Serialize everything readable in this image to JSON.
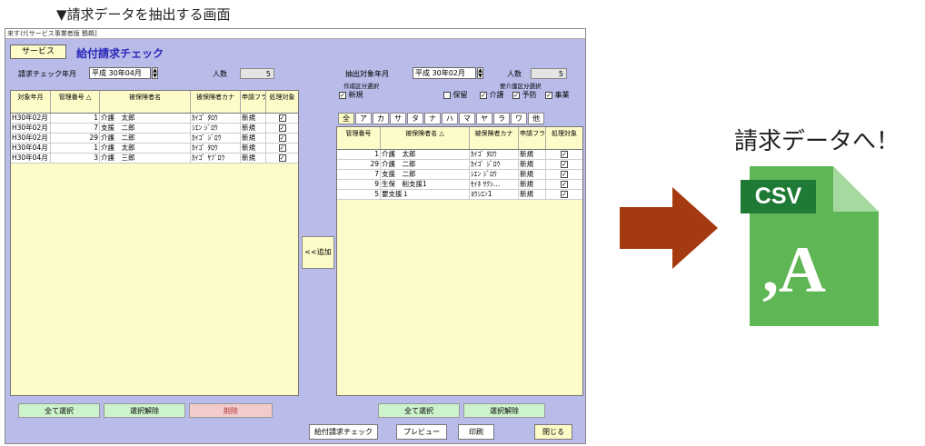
{
  "caption": "▼請求データを抽出する画面",
  "window": {
    "titlebar": "来すけ[サービス事業者版 鶴鵜]",
    "service_btn": "サービス",
    "screen_title": "給付請求チェック"
  },
  "left": {
    "check_month_label": "請求チェック年月",
    "check_month_value": "平成 30年04月",
    "count_label": "人数",
    "count_value": "5",
    "headers": [
      "対象年月",
      "管理番号 △",
      "被保険者名",
      "被保険者カナ",
      "申請フラグ",
      "処理対象"
    ],
    "rows": [
      {
        "month": "H30年02月",
        "no": "1",
        "name": "介護　太郎",
        "kana": "ｶｲｺﾞ ﾀﾛｳ",
        "flag": "新規",
        "chk": "☑"
      },
      {
        "month": "H30年02月",
        "no": "7",
        "name": "支援　二郎",
        "kana": "ｼｴﾝ ｼﾞﾛｳ",
        "flag": "新規",
        "chk": "☑"
      },
      {
        "month": "H30年02月",
        "no": "29",
        "name": "介護　二郎",
        "kana": "ｶｲｺﾞ ｼﾞﾛｳ",
        "flag": "新規",
        "chk": "☑"
      },
      {
        "month": "H30年04月",
        "no": "1",
        "name": "介護　太郎",
        "kana": "ｶｲｺﾞ ﾀﾛｳ",
        "flag": "新規",
        "chk": "☑"
      },
      {
        "month": "H30年04月",
        "no": "3",
        "name": "介護　三郎",
        "kana": "ｶｲｺﾞ ｻﾌﾞﾛｳ",
        "flag": "新規",
        "chk": "☑"
      }
    ],
    "select_all": "全て選択",
    "deselect": "選択解除",
    "delete": "削除"
  },
  "add_btn": "<<追加",
  "right": {
    "extract_month_label": "抽出対象年月",
    "extract_month_value": "平成 30年02月",
    "count_label": "人数",
    "count_value": "5",
    "creation_label": "作成区分選択",
    "new_label": "新規",
    "hold_label": "保留",
    "care_label": "要介護区分選択",
    "kaigo_label": "介護",
    "yobo_label": "予防",
    "jigyo_label": "事業",
    "tabs": [
      "全",
      "ア",
      "カ",
      "サ",
      "タ",
      "ナ",
      "ハ",
      "マ",
      "ヤ",
      "ラ",
      "ワ",
      "他"
    ],
    "headers": [
      "管理番号",
      "被保険者名 △",
      "被保険者カナ",
      "申請フラグ",
      "処理対象"
    ],
    "rows": [
      {
        "no": "1",
        "name": "介護　太郎",
        "kana": "ｶｲｺﾞ ﾀﾛｳ",
        "flag": "新規",
        "chk": "☑"
      },
      {
        "no": "29",
        "name": "介護　二郎",
        "kana": "ｶｲｺﾞ ｼﾞﾛｳ",
        "flag": "新規",
        "chk": "☑"
      },
      {
        "no": "7",
        "name": "支援　二郎",
        "kana": "ｼｴﾝ ｼﾞﾛｳ",
        "flag": "新規",
        "chk": "☑"
      },
      {
        "no": "9",
        "name": "生保　削支援1",
        "kana": "ｾｲﾎ ｻｸｼ…",
        "flag": "新規",
        "chk": "☑"
      },
      {
        "no": "5",
        "name": "要支援１",
        "kana": "ﾖｳｼｴﾝ1",
        "flag": "新規",
        "chk": "☑"
      }
    ],
    "select_all": "全て選択",
    "deselect": "選択解除"
  },
  "bottom": {
    "check_btn": "給付請求チェック",
    "preview_btn": "プレビュー",
    "print_btn": "印刷",
    "close_btn": "閉じる"
  },
  "side": {
    "label": "請求データへ！",
    "csv_badge": "CSV",
    "file_glyph": ",A"
  },
  "colors": {
    "arrow": "#a53a10",
    "file": "#5fb655",
    "badge": "#1f7a36",
    "fold": "#a6d99f"
  }
}
